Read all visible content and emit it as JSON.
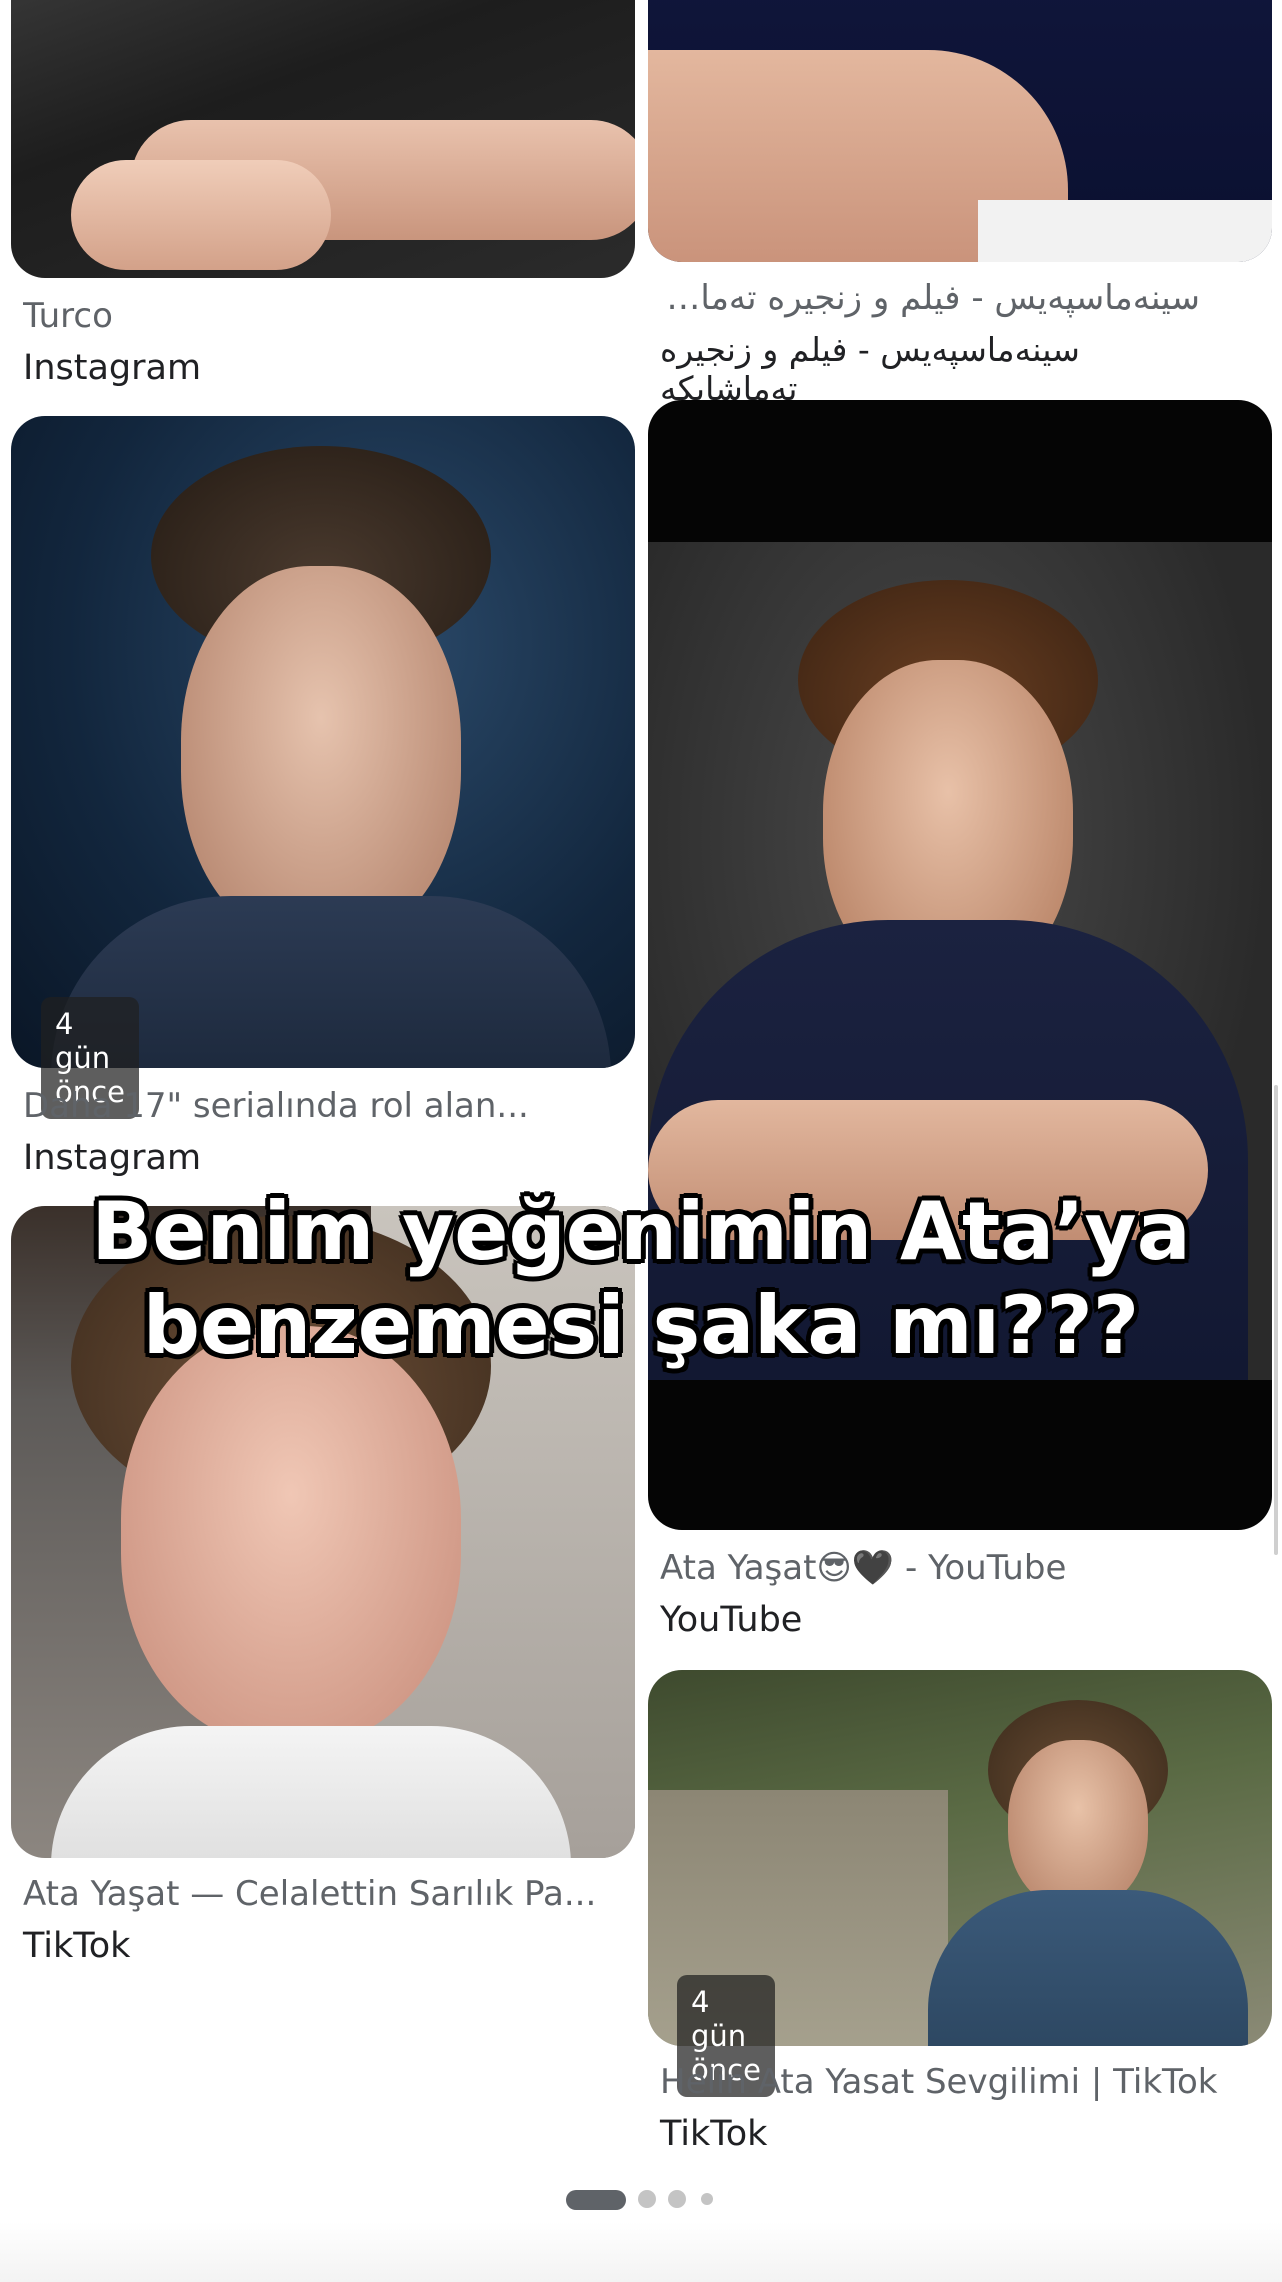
{
  "results": [
    {
      "caption": "Turco",
      "source": "Instagram"
    },
    {
      "caption": "سینەماسپەیس - فیلم و زنجیرە تەماشابکە",
      "source": "سینەماسپەیس - فیلم و زنجیرە تەماشابکە"
    },
    {
      "caption": "Daha 17\" serialında rol alan...",
      "source": "Instagram",
      "badge": "4 gün önce"
    },
    {
      "caption": "Ata Yaşat😎🖤 - YouTube",
      "source": "YouTube"
    },
    {
      "caption": "Ata Yaşat — Celalettin Sarılık Pa...",
      "source": "TikTok"
    },
    {
      "caption": "Helin Ata Yasat Sevgilimi | TikTok",
      "source": "TikTok",
      "badge": "4 gün önce"
    }
  ],
  "overlay": {
    "line1": "Benim yeğenimin Ata’ya",
    "line2": "benzemesi şaka mı???"
  },
  "pager": {
    "pages": 4,
    "current": 1
  },
  "colors": {
    "caption": "#5f6368",
    "source": "#202124",
    "badge_bg": "#202020"
  }
}
